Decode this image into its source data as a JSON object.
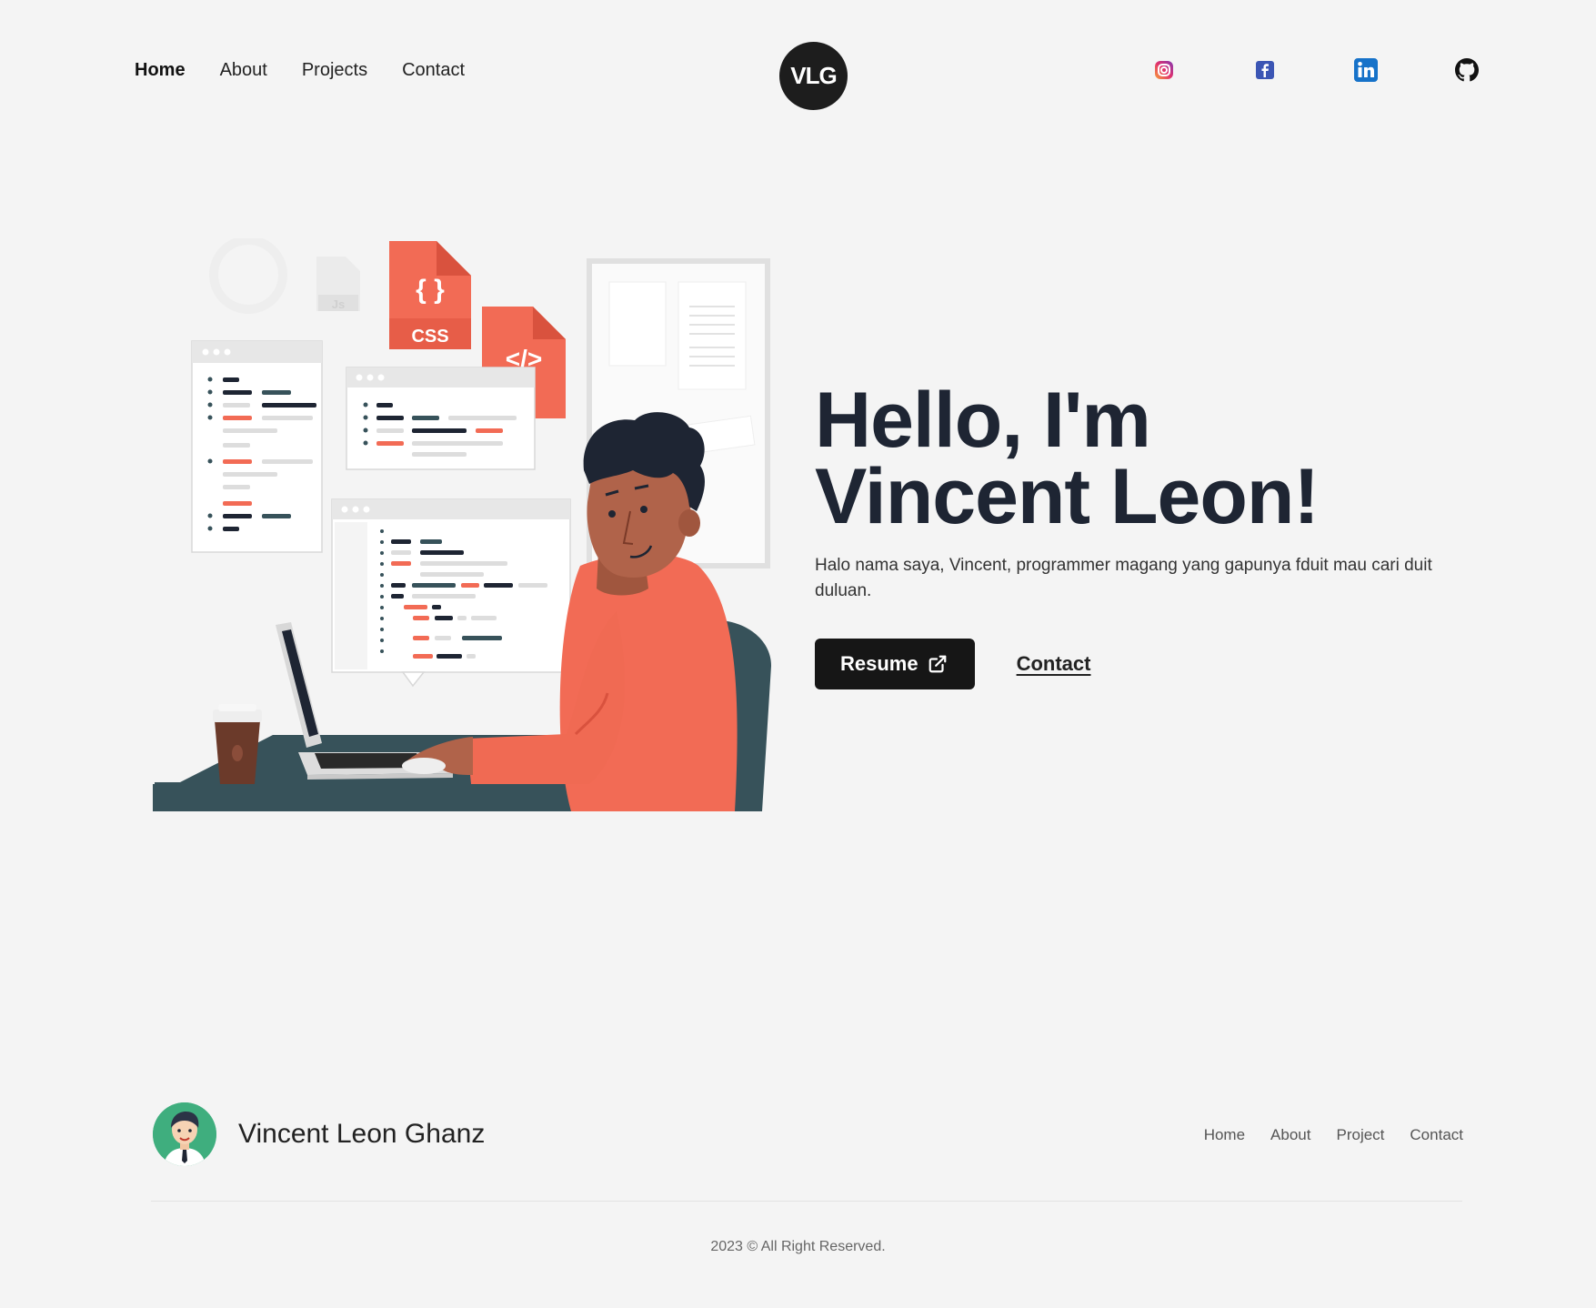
{
  "nav": {
    "links": [
      "Home",
      "About",
      "Projects",
      "Contact"
    ],
    "logo_text": "VLG",
    "socials": [
      "instagram-icon",
      "facebook-icon",
      "linkedin-icon",
      "github-icon"
    ]
  },
  "hero": {
    "title_line1": "Hello, I'm",
    "title_line2": "Vincent Leon!",
    "subtitle": "Halo nama saya, Vincent, programmer magang yang gapunya fduit mau cari duit duluan.",
    "resume_label": "Resume",
    "contact_label": "Contact",
    "illustration_labels": {
      "css": "CSS",
      "html": "</>",
      "js": "Js"
    }
  },
  "footer": {
    "name": "Vincent Leon Ghanz",
    "links": [
      "Home",
      "About",
      "Project",
      "Contact"
    ],
    "copyright": "2023 © All Right Reserved."
  },
  "colors": {
    "background": "#f4f4f4",
    "dark": "#161616",
    "accent": "#f26b55",
    "teal": "#37525a"
  }
}
